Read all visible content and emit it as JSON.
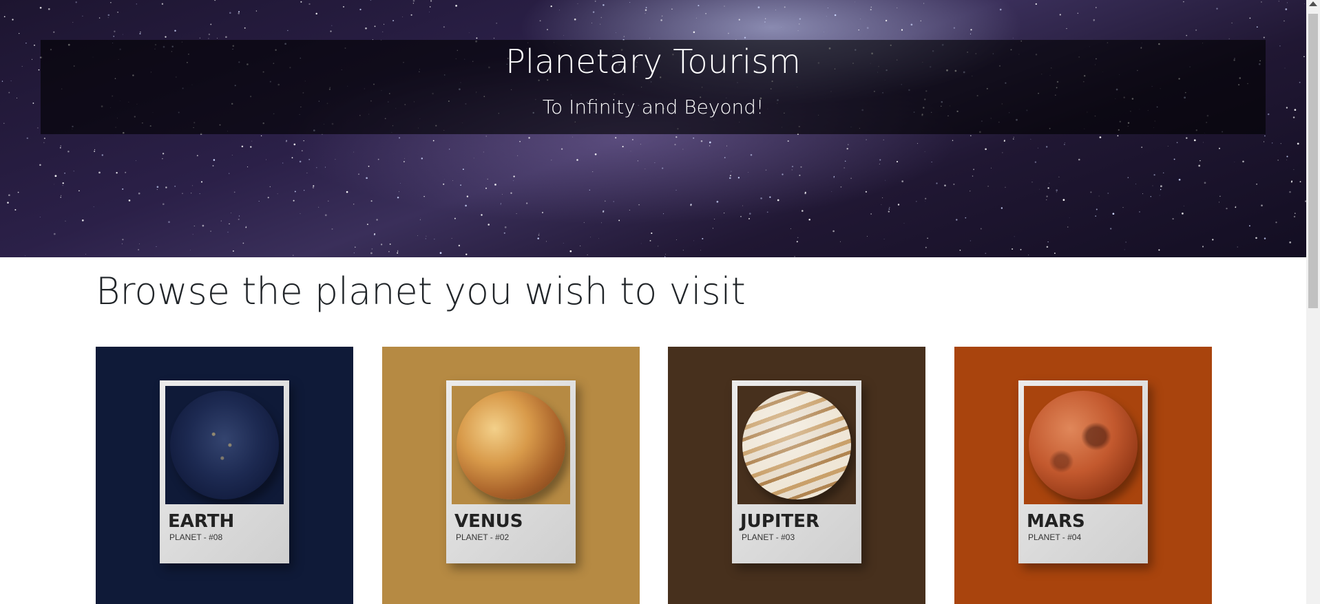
{
  "hero": {
    "title": "Planetary Tourism",
    "subtitle": "To Infinity and Beyond!"
  },
  "browse": {
    "heading": "Browse the planet you wish to visit"
  },
  "planets": [
    {
      "name": "EARTH",
      "code": "PLANET - #08",
      "bg_color": "#0f1a38"
    },
    {
      "name": "VENUS",
      "code": "PLANET - #02",
      "bg_color": "#b68a43"
    },
    {
      "name": "JUPITER",
      "code": "PLANET - #03",
      "bg_color": "#47301d"
    },
    {
      "name": "MARS",
      "code": "PLANET - #04",
      "bg_color": "#a9440d"
    }
  ],
  "icons": {
    "scroll_up": "chevron-up-icon"
  }
}
